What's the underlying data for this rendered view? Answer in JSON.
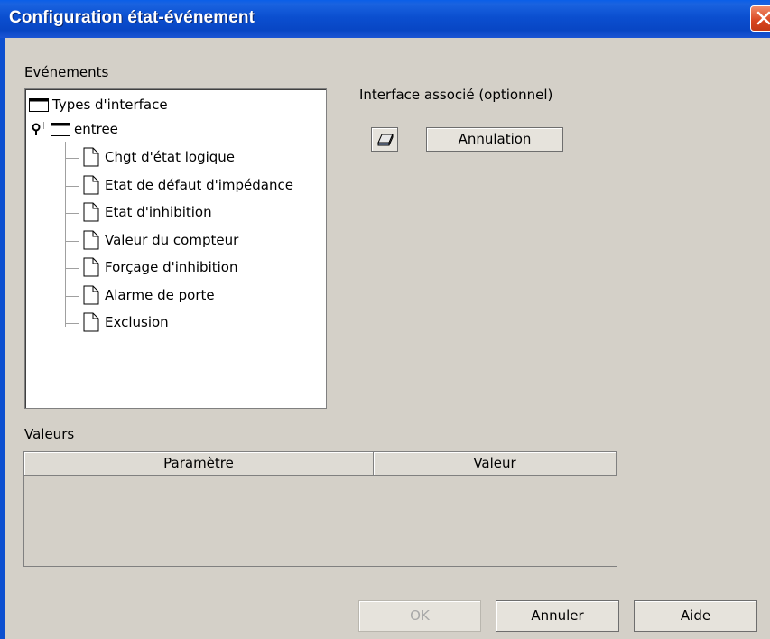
{
  "window": {
    "title": "Configuration état-événement"
  },
  "events": {
    "label": "Evénements",
    "tree": {
      "root": "Types d'interface",
      "group": "entree",
      "items": [
        "Chgt d'état logique",
        "Etat de défaut d'impédance",
        "Etat d'inhibition",
        "Valeur du compteur",
        "Forçage d'inhibition",
        "Alarme de porte",
        "Exclusion"
      ]
    }
  },
  "interface": {
    "label": "Interface associé (optionnel)",
    "cancel_button": "Annulation",
    "icon": "eraser-icon"
  },
  "values": {
    "label": "Valeurs",
    "columns": [
      "Paramètre",
      "Valeur"
    ],
    "rows": []
  },
  "buttons": {
    "ok": "OK",
    "cancel": "Annuler",
    "help": "Aide"
  },
  "colors": {
    "titlebar": "#0b4fd0",
    "close": "#d8451f",
    "dialog": "#d4d0c8"
  }
}
